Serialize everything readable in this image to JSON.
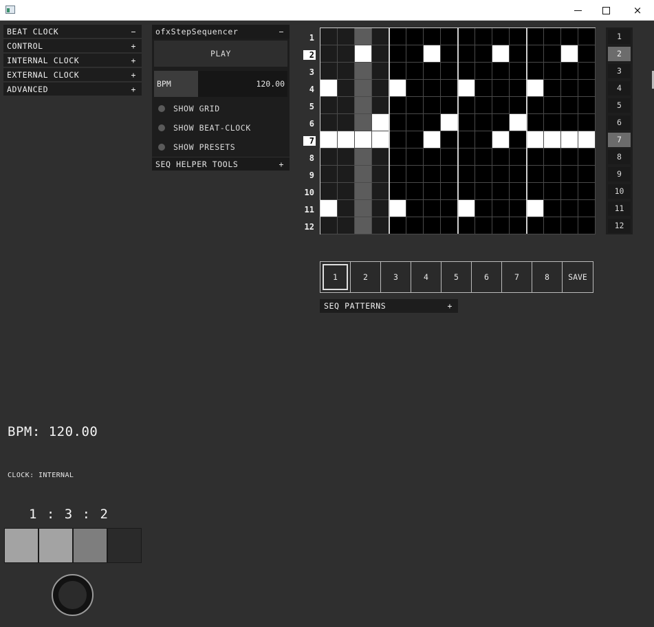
{
  "window": {
    "minimize_glyph": "minimize-icon",
    "maximize_glyph": "maximize-icon",
    "close_glyph": "×"
  },
  "beat_clock_panel": {
    "items": [
      {
        "label": "BEAT CLOCK",
        "sign": "−"
      },
      {
        "label": "CONTROL",
        "sign": "+"
      },
      {
        "label": "INTERNAL CLOCK",
        "sign": "+"
      },
      {
        "label": "EXTERNAL CLOCK",
        "sign": "+"
      },
      {
        "label": "ADVANCED",
        "sign": "+"
      }
    ]
  },
  "sequencer_panel": {
    "title": "ofxStepSequencer",
    "collapse_sign": "−",
    "play_label": "PLAY",
    "bpm_label": "BPM",
    "bpm_value": "120.00",
    "bpm_slider_fraction": 0.33,
    "toggles": [
      {
        "label": "SHOW GRID",
        "on": false
      },
      {
        "label": "SHOW BEAT-CLOCK",
        "on": false
      },
      {
        "label": "SHOW PRESETS",
        "on": false
      }
    ],
    "helper_label": "SEQ HELPER TOOLS",
    "helper_sign": "+"
  },
  "grid": {
    "row_labels": [
      "1",
      "2",
      "3",
      "4",
      "5",
      "6",
      "7",
      "8",
      "9",
      "10",
      "11",
      "12"
    ],
    "highlighted_rows": [
      2,
      7
    ],
    "active_step_column": 3,
    "columns": 16,
    "rows": 12,
    "on_cells": [
      [
        2,
        3
      ],
      [
        2,
        7
      ],
      [
        2,
        11
      ],
      [
        2,
        15
      ],
      [
        4,
        1
      ],
      [
        4,
        5
      ],
      [
        4,
        9
      ],
      [
        4,
        13
      ],
      [
        6,
        4
      ],
      [
        6,
        8
      ],
      [
        6,
        12
      ],
      [
        7,
        1
      ],
      [
        7,
        2
      ],
      [
        7,
        3
      ],
      [
        7,
        4
      ],
      [
        7,
        7
      ],
      [
        7,
        11
      ],
      [
        7,
        13
      ],
      [
        7,
        14
      ],
      [
        7,
        15
      ],
      [
        7,
        16
      ],
      [
        11,
        1
      ],
      [
        11,
        5
      ],
      [
        11,
        9
      ],
      [
        11,
        13
      ]
    ]
  },
  "row_column": {
    "labels": [
      "1",
      "2",
      "3",
      "4",
      "5",
      "6",
      "7",
      "8",
      "9",
      "10",
      "11",
      "12"
    ],
    "active": [
      2,
      7
    ]
  },
  "patterns": {
    "labels": [
      "1",
      "2",
      "3",
      "4",
      "5",
      "6",
      "7",
      "8",
      "SAVE"
    ],
    "selected": 1,
    "section_label": "SEQ PATTERNS",
    "section_sign": "+"
  },
  "status": {
    "bpm_text": "BPM: 120.00",
    "clock_text": "CLOCK: INTERNAL",
    "beat_counter": "1 : 3 : 2",
    "beat_boxes": [
      "#a3a3a3",
      "#a3a3a3",
      "#7e7e7e",
      "#2a2a2a"
    ]
  },
  "colors": {
    "background": "#2f2f2f",
    "cell_on": "#ffffff",
    "cell_off_playing": "#000000",
    "cell_off_past": "#1c1c1c",
    "cell_active_col": "#5c5c5c",
    "row_active": "#6c6c6c"
  }
}
